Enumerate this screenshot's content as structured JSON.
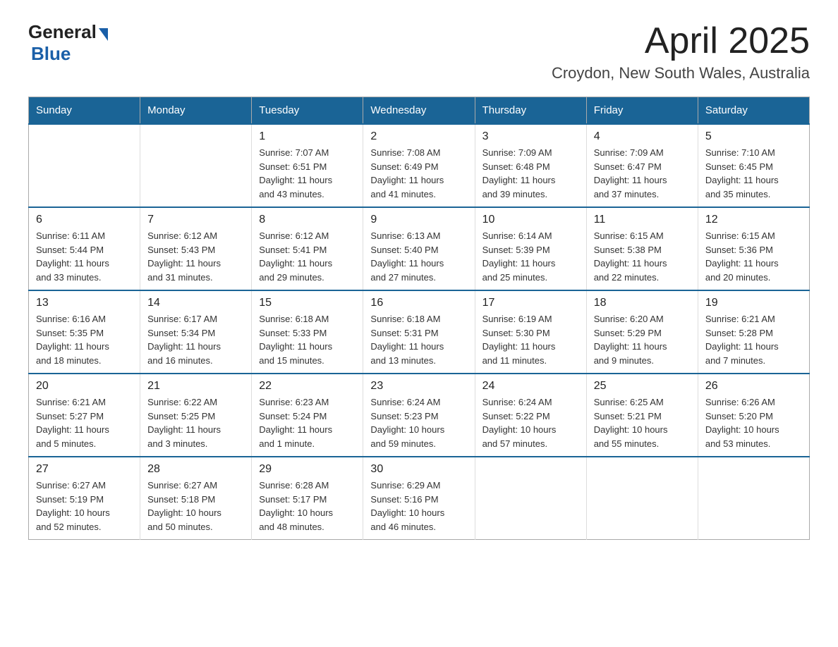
{
  "header": {
    "logo_general": "General",
    "logo_blue": "Blue",
    "title": "April 2025",
    "subtitle": "Croydon, New South Wales, Australia"
  },
  "calendar": {
    "days_of_week": [
      "Sunday",
      "Monday",
      "Tuesday",
      "Wednesday",
      "Thursday",
      "Friday",
      "Saturday"
    ],
    "weeks": [
      {
        "days": [
          {
            "number": "",
            "info": ""
          },
          {
            "number": "",
            "info": ""
          },
          {
            "number": "1",
            "info": "Sunrise: 7:07 AM\nSunset: 6:51 PM\nDaylight: 11 hours\nand 43 minutes."
          },
          {
            "number": "2",
            "info": "Sunrise: 7:08 AM\nSunset: 6:49 PM\nDaylight: 11 hours\nand 41 minutes."
          },
          {
            "number": "3",
            "info": "Sunrise: 7:09 AM\nSunset: 6:48 PM\nDaylight: 11 hours\nand 39 minutes."
          },
          {
            "number": "4",
            "info": "Sunrise: 7:09 AM\nSunset: 6:47 PM\nDaylight: 11 hours\nand 37 minutes."
          },
          {
            "number": "5",
            "info": "Sunrise: 7:10 AM\nSunset: 6:45 PM\nDaylight: 11 hours\nand 35 minutes."
          }
        ]
      },
      {
        "days": [
          {
            "number": "6",
            "info": "Sunrise: 6:11 AM\nSunset: 5:44 PM\nDaylight: 11 hours\nand 33 minutes."
          },
          {
            "number": "7",
            "info": "Sunrise: 6:12 AM\nSunset: 5:43 PM\nDaylight: 11 hours\nand 31 minutes."
          },
          {
            "number": "8",
            "info": "Sunrise: 6:12 AM\nSunset: 5:41 PM\nDaylight: 11 hours\nand 29 minutes."
          },
          {
            "number": "9",
            "info": "Sunrise: 6:13 AM\nSunset: 5:40 PM\nDaylight: 11 hours\nand 27 minutes."
          },
          {
            "number": "10",
            "info": "Sunrise: 6:14 AM\nSunset: 5:39 PM\nDaylight: 11 hours\nand 25 minutes."
          },
          {
            "number": "11",
            "info": "Sunrise: 6:15 AM\nSunset: 5:38 PM\nDaylight: 11 hours\nand 22 minutes."
          },
          {
            "number": "12",
            "info": "Sunrise: 6:15 AM\nSunset: 5:36 PM\nDaylight: 11 hours\nand 20 minutes."
          }
        ]
      },
      {
        "days": [
          {
            "number": "13",
            "info": "Sunrise: 6:16 AM\nSunset: 5:35 PM\nDaylight: 11 hours\nand 18 minutes."
          },
          {
            "number": "14",
            "info": "Sunrise: 6:17 AM\nSunset: 5:34 PM\nDaylight: 11 hours\nand 16 minutes."
          },
          {
            "number": "15",
            "info": "Sunrise: 6:18 AM\nSunset: 5:33 PM\nDaylight: 11 hours\nand 15 minutes."
          },
          {
            "number": "16",
            "info": "Sunrise: 6:18 AM\nSunset: 5:31 PM\nDaylight: 11 hours\nand 13 minutes."
          },
          {
            "number": "17",
            "info": "Sunrise: 6:19 AM\nSunset: 5:30 PM\nDaylight: 11 hours\nand 11 minutes."
          },
          {
            "number": "18",
            "info": "Sunrise: 6:20 AM\nSunset: 5:29 PM\nDaylight: 11 hours\nand 9 minutes."
          },
          {
            "number": "19",
            "info": "Sunrise: 6:21 AM\nSunset: 5:28 PM\nDaylight: 11 hours\nand 7 minutes."
          }
        ]
      },
      {
        "days": [
          {
            "number": "20",
            "info": "Sunrise: 6:21 AM\nSunset: 5:27 PM\nDaylight: 11 hours\nand 5 minutes."
          },
          {
            "number": "21",
            "info": "Sunrise: 6:22 AM\nSunset: 5:25 PM\nDaylight: 11 hours\nand 3 minutes."
          },
          {
            "number": "22",
            "info": "Sunrise: 6:23 AM\nSunset: 5:24 PM\nDaylight: 11 hours\nand 1 minute."
          },
          {
            "number": "23",
            "info": "Sunrise: 6:24 AM\nSunset: 5:23 PM\nDaylight: 10 hours\nand 59 minutes."
          },
          {
            "number": "24",
            "info": "Sunrise: 6:24 AM\nSunset: 5:22 PM\nDaylight: 10 hours\nand 57 minutes."
          },
          {
            "number": "25",
            "info": "Sunrise: 6:25 AM\nSunset: 5:21 PM\nDaylight: 10 hours\nand 55 minutes."
          },
          {
            "number": "26",
            "info": "Sunrise: 6:26 AM\nSunset: 5:20 PM\nDaylight: 10 hours\nand 53 minutes."
          }
        ]
      },
      {
        "days": [
          {
            "number": "27",
            "info": "Sunrise: 6:27 AM\nSunset: 5:19 PM\nDaylight: 10 hours\nand 52 minutes."
          },
          {
            "number": "28",
            "info": "Sunrise: 6:27 AM\nSunset: 5:18 PM\nDaylight: 10 hours\nand 50 minutes."
          },
          {
            "number": "29",
            "info": "Sunrise: 6:28 AM\nSunset: 5:17 PM\nDaylight: 10 hours\nand 48 minutes."
          },
          {
            "number": "30",
            "info": "Sunrise: 6:29 AM\nSunset: 5:16 PM\nDaylight: 10 hours\nand 46 minutes."
          },
          {
            "number": "",
            "info": ""
          },
          {
            "number": "",
            "info": ""
          },
          {
            "number": "",
            "info": ""
          }
        ]
      }
    ]
  }
}
